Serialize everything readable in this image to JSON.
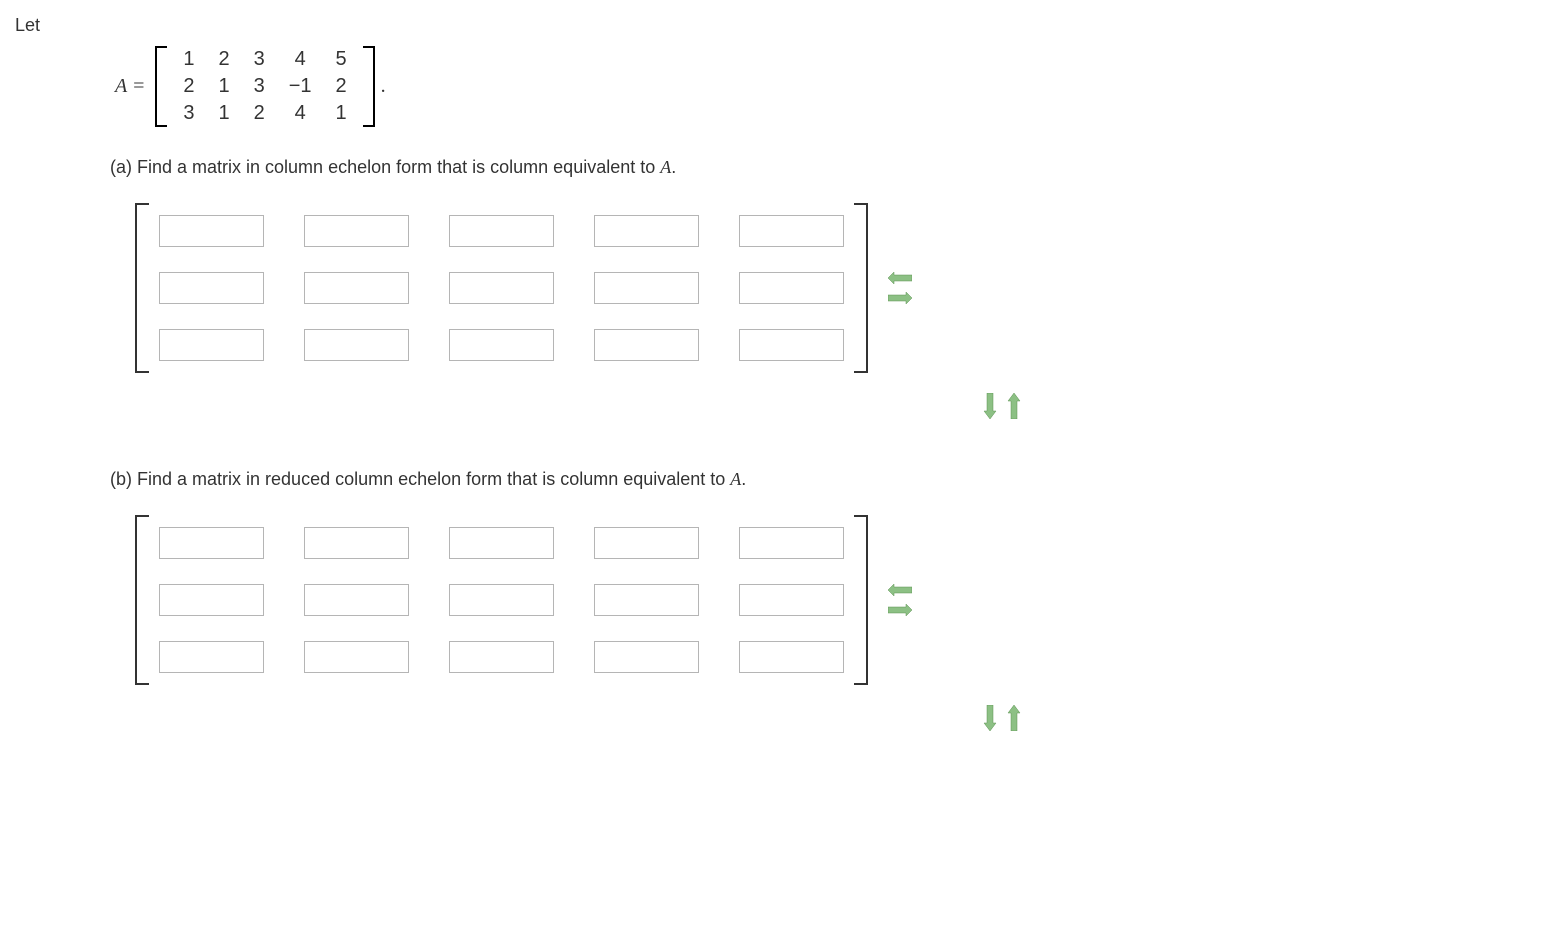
{
  "intro": "Let",
  "matrixLabel": "A =",
  "matrix": {
    "rows": [
      [
        "1",
        "2",
        "3",
        "4",
        "5"
      ],
      [
        "2",
        "1",
        "3",
        "−1",
        "2"
      ],
      [
        "3",
        "1",
        "2",
        "4",
        "1"
      ]
    ]
  },
  "period": ".",
  "parts": {
    "a": {
      "label": "(a) Find a matrix in column echelon form that is column equivalent to ",
      "varA": "A",
      "endPunct": "."
    },
    "b": {
      "label": "(b) Find a matrix in reduced column echelon form that is column equivalent to ",
      "varA": "A",
      "endPunct": "."
    }
  },
  "inputMatrix": {
    "rows": 3,
    "cols": 5
  }
}
